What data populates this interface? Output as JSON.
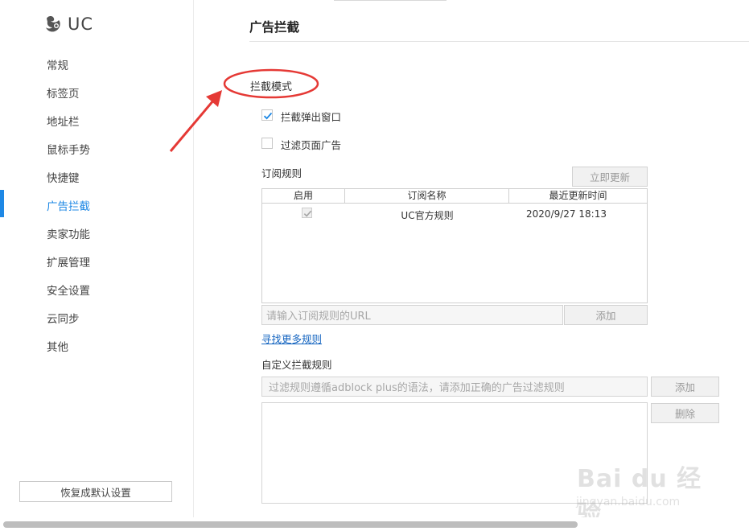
{
  "sidebar": {
    "brand": "UC",
    "items": [
      {
        "label": "常规"
      },
      {
        "label": "标签页"
      },
      {
        "label": "地址栏"
      },
      {
        "label": "鼠标手势"
      },
      {
        "label": "快捷键"
      },
      {
        "label": "广告拦截",
        "active": true
      },
      {
        "label": "卖家功能"
      },
      {
        "label": "扩展管理"
      },
      {
        "label": "安全设置"
      },
      {
        "label": "云同步"
      },
      {
        "label": "其他"
      }
    ],
    "reset_label": "恢复成默认设置"
  },
  "main": {
    "title": "广告拦截",
    "mode_label": "拦截模式",
    "options": [
      {
        "label": "拦截弹出窗口",
        "checked": true
      },
      {
        "label": "过滤页面广告",
        "checked": false
      }
    ],
    "subscription": {
      "label": "订阅规则",
      "update_button": "立即更新",
      "columns": [
        "启用",
        "订阅名称",
        "最近更新时间"
      ],
      "rows": [
        {
          "enabled": true,
          "name": "UC官方规则",
          "updated": "2020/9/27 18:13"
        }
      ],
      "url_placeholder": "请输入订阅规则的URL",
      "add_button": "添加"
    },
    "find_more": "寻找更多规则",
    "custom": {
      "label": "自定义拦截规则",
      "placeholder": "过滤规则遵循adblock plus的语法，请添加正确的广告过滤规则",
      "add_button": "添加",
      "delete_button": "删除"
    }
  },
  "watermark": {
    "line1": "Bai du 经验",
    "line2": "jingyan.baidu.com"
  },
  "colors": {
    "accent": "#1e88e5",
    "annotation": "#e53935"
  }
}
